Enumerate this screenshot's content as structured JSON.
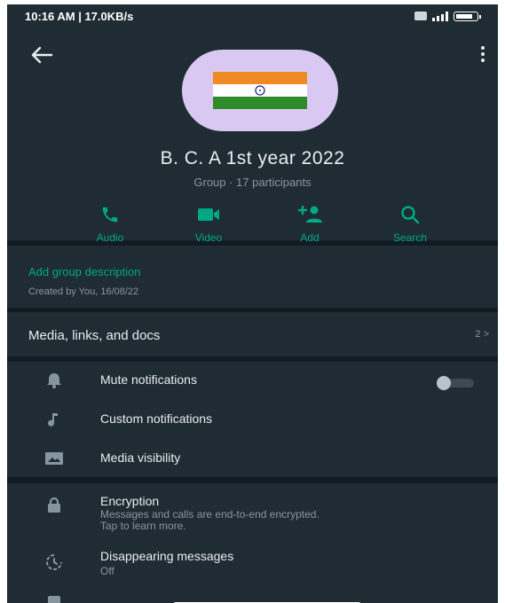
{
  "status_bar": {
    "time_speed": "10:16 AM | 17.0KB/s"
  },
  "header": {
    "group_name": "B. C. A 1st year 2022",
    "group_subtitle": "Group · 17 participants",
    "avatar_icon": "india-flag-icon"
  },
  "actions": [
    {
      "label": "Audio",
      "icon": "phone-icon"
    },
    {
      "label": "Video",
      "icon": "video-camera-icon"
    },
    {
      "label": "Add",
      "icon": "add-person-icon"
    },
    {
      "label": "Search",
      "icon": "search-icon"
    }
  ],
  "description": {
    "add_label": "Add group description",
    "created_by": "Created by You, 16/08/22"
  },
  "media": {
    "label": "Media, links, and docs",
    "count": "2 >"
  },
  "settings": {
    "mute": "Mute notifications",
    "custom": "Custom notifications",
    "visibility": "Media visibility",
    "mute_enabled": false
  },
  "privacy": {
    "encryption_title": "Encryption",
    "encryption_line1": "Messages and calls are end-to-end encrypted.",
    "encryption_line2": "Tap to learn more.",
    "disappearing_title": "Disappearing messages",
    "disappearing_value": "Off"
  },
  "colors": {
    "accent": "#00a884",
    "background": "#121b22",
    "panel": "#1f2c34",
    "text": "#e9edef",
    "muted": "#8696a0"
  }
}
